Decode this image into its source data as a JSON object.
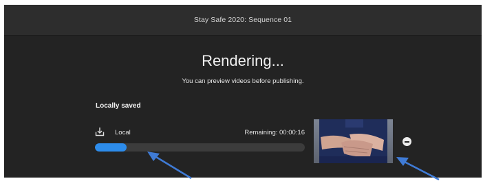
{
  "window": {
    "title": "Stay Safe 2020: Sequence 01"
  },
  "render": {
    "heading": "Rendering...",
    "subheading": "You can preview videos before publishing."
  },
  "section": {
    "label": "Locally saved"
  },
  "export_item": {
    "icon": "download-to-device-icon",
    "destination": "Local",
    "remaining": "Remaining: 00:00:16",
    "progress": 0.15,
    "thumbnail": "video-frame-hands-thumbnail",
    "cancel_icon": "minus-circle-icon"
  },
  "annotations": {
    "arrow_color": "#3f7bd6"
  },
  "colors": {
    "background": "#232323",
    "titlebar": "#2d2d2d",
    "accent": "#2d8ceb",
    "track": "#3c3c3c"
  }
}
